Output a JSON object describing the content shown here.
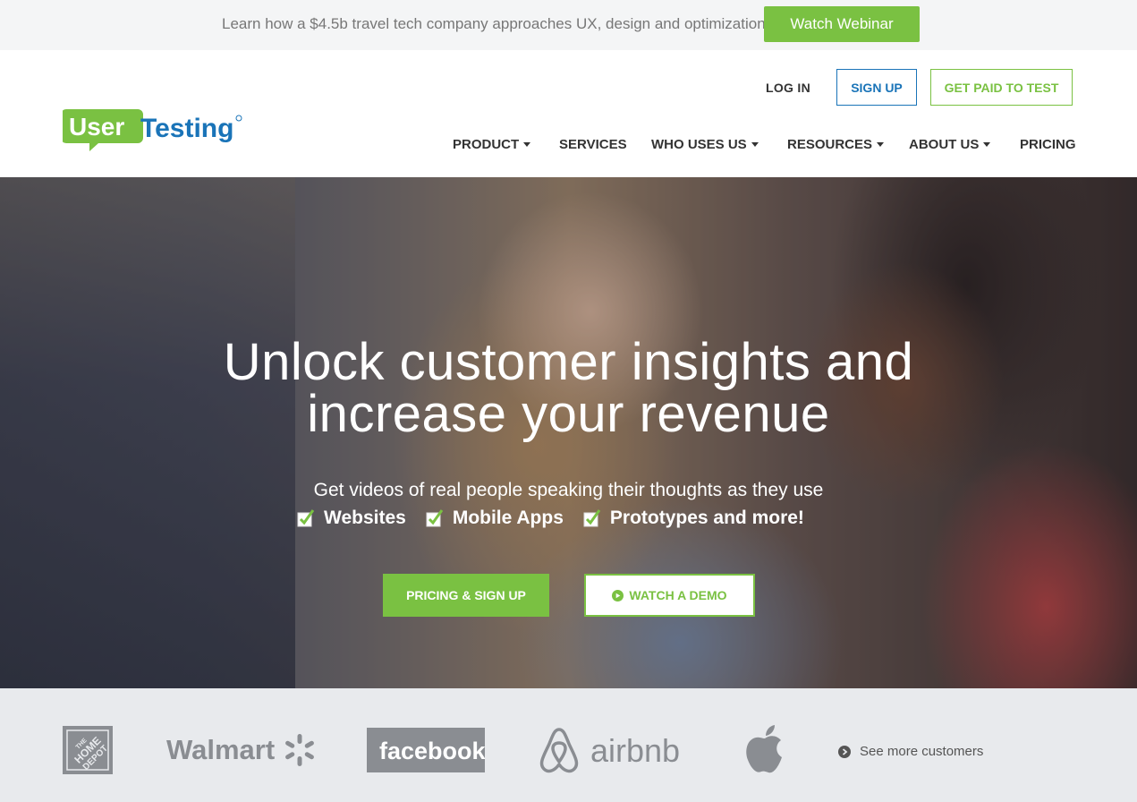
{
  "announcement": {
    "text": "Learn how a $4.5b travel tech company approaches UX, design and optimization",
    "button": "Watch Webinar"
  },
  "header": {
    "logo_text": "UserTesting",
    "login": "LOG IN",
    "signup": "SIGN UP",
    "get_paid": "GET PAID TO TEST",
    "nav": [
      {
        "label": "PRODUCT",
        "dropdown": true
      },
      {
        "label": "SERVICES",
        "dropdown": false
      },
      {
        "label": "WHO USES US",
        "dropdown": true
      },
      {
        "label": "RESOURCES",
        "dropdown": true
      },
      {
        "label": "ABOUT US",
        "dropdown": true
      },
      {
        "label": "PRICING",
        "dropdown": false
      }
    ]
  },
  "hero": {
    "title_line1": "Unlock customer insights and",
    "title_line2": "increase your revenue",
    "subtitle": "Get videos of real people speaking their thoughts as they use",
    "checks": [
      "Websites",
      "Mobile Apps",
      "Prototypes and more!"
    ],
    "cta_primary": "PRICING & SIGN UP",
    "cta_secondary": "WATCH A DEMO"
  },
  "customers": {
    "logos": [
      "The Home Depot",
      "Walmart",
      "facebook",
      "airbnb",
      "Apple"
    ],
    "see_more": "See more customers"
  },
  "colors": {
    "green": "#7ac142",
    "blue": "#1a74b8",
    "gray_text": "#777777",
    "logo_gray": "#8a8d92"
  },
  "icons": [
    "caret-down-icon",
    "check-icon",
    "play-icon",
    "chevron-right-icon",
    "apple-icon",
    "walmart-spark-icon",
    "airbnb-icon"
  ]
}
